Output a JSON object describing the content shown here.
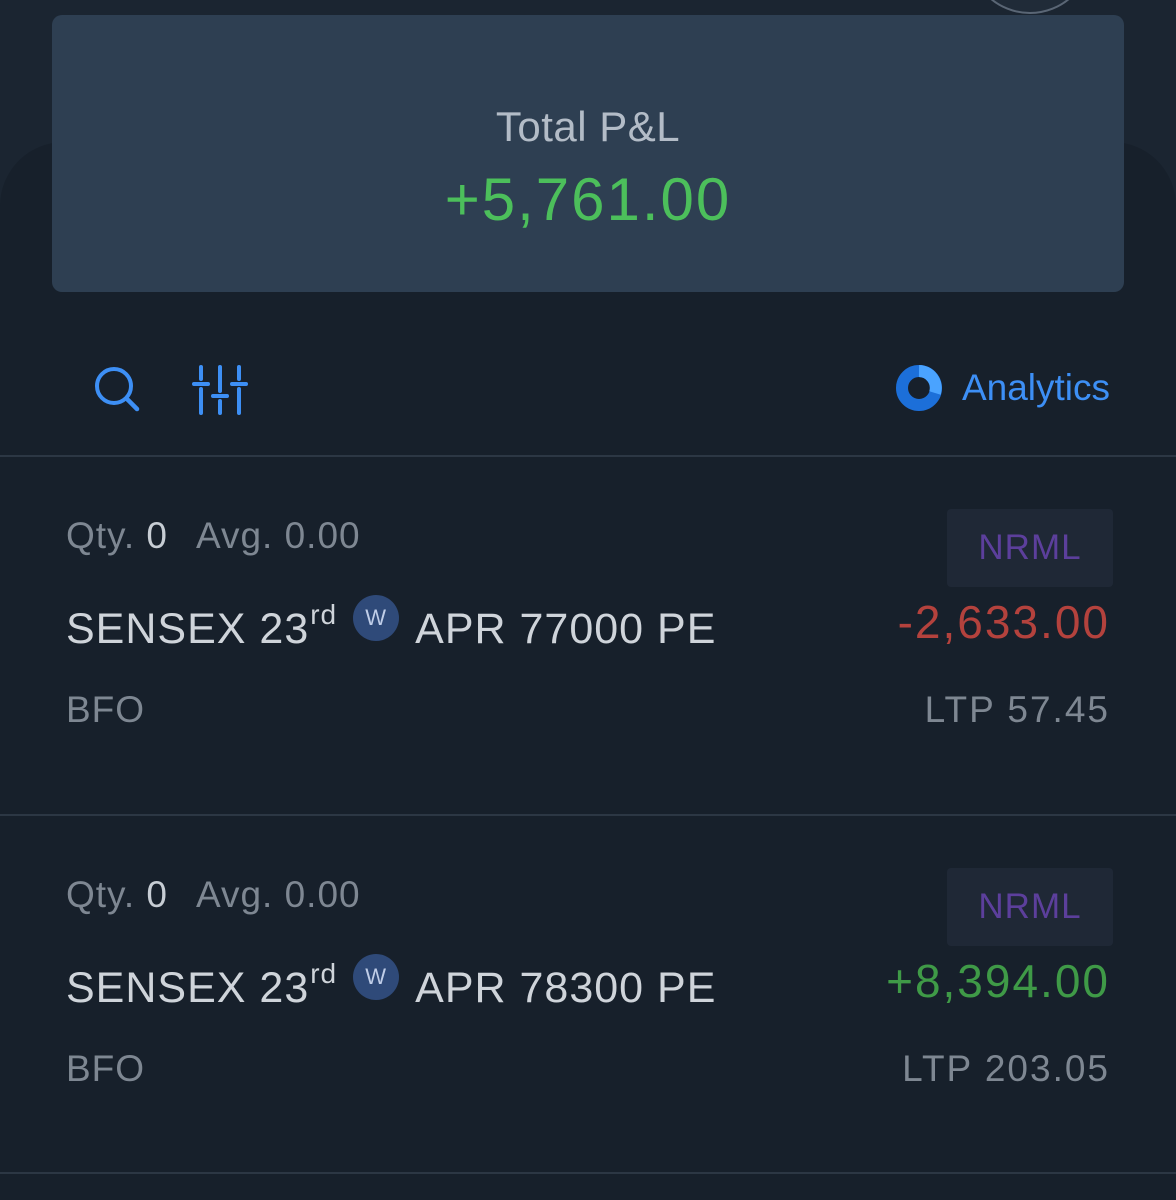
{
  "summary": {
    "title": "Total P&L",
    "value": "+5,761.00"
  },
  "toolbar": {
    "search_icon": "search-icon",
    "filter_icon": "sliders-icon",
    "analytics_label": "Analytics"
  },
  "colors": {
    "profit": "#4cbf5b",
    "loss": "#b4423d",
    "accent": "#3d8ff5",
    "product_badge": "#5c3f9c"
  },
  "positions": [
    {
      "qty_label": "Qty.",
      "qty": "0",
      "avg_label": "Avg.",
      "avg": "0.00",
      "product": "NRML",
      "underlying": "SENSEX 23",
      "date_suffix": "rd",
      "weekly_badge": "W",
      "contract": "APR 77000 PE",
      "pnl": "-2,633.00",
      "pnl_status": "loss",
      "exchange": "BFO",
      "ltp": "LTP 57.45"
    },
    {
      "qty_label": "Qty.",
      "qty": "0",
      "avg_label": "Avg.",
      "avg": "0.00",
      "product": "NRML",
      "underlying": "SENSEX 23",
      "date_suffix": "rd",
      "weekly_badge": "W",
      "contract": "APR 78300 PE",
      "pnl": "+8,394.00",
      "pnl_status": "profit",
      "exchange": "BFO",
      "ltp": "LTP 203.05"
    }
  ]
}
